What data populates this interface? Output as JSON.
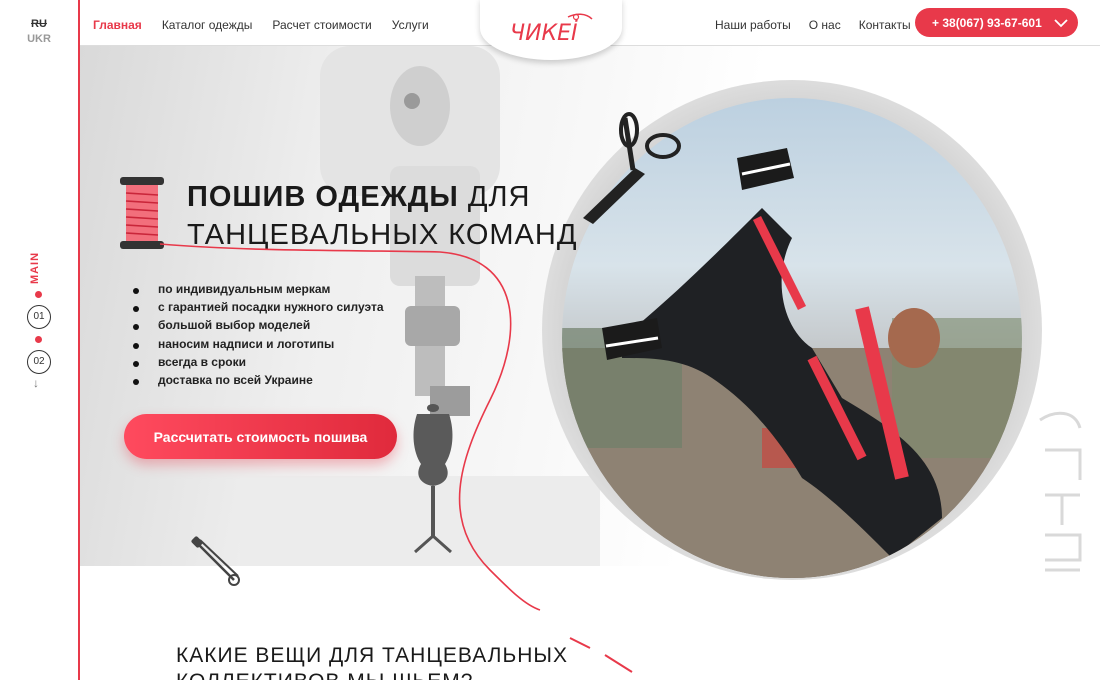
{
  "lang": {
    "ru": "RU",
    "ukr": "UKR"
  },
  "rail": {
    "main_label": "MAIN",
    "slide_1": "01",
    "slide_2": "02",
    "arrow": "↓"
  },
  "nav": {
    "left": [
      "Главная",
      "Каталог одежды",
      "Расчет стоимости",
      "Услуги"
    ],
    "right": [
      "Наши работы",
      "О нас",
      "Контакты"
    ],
    "logo": "ЧИКЕİ",
    "phone": "+ 38(067) 93-67-601",
    "phone_icon": "chevron-down-icon"
  },
  "hero": {
    "title_bold": "ПОШИВ ОДЕЖДЫ",
    "title_rest": " ДЛЯ",
    "title_line2": "ТАНЦЕВАЛЬНЫХ КОМАНД",
    "features": [
      "по индивидуальным меркам",
      "с гарантией посадки нужного силуэта",
      "большой выбор моделей",
      "наносим надписи и логотипы",
      "всегда в сроки",
      "доставка по всей Украине"
    ],
    "cta": "Рассчитать стоимость пошива"
  },
  "section": {
    "title_line1": "КАКИЕ ВЕЩИ ДЛЯ ТАНЦЕВАЛЬНЫХ",
    "title_line2": "КОЛЛЕКТИВОВ МЫ ШЬЕМ?"
  },
  "colors": {
    "accent": "#e8394a",
    "text": "#1a1a1a"
  }
}
